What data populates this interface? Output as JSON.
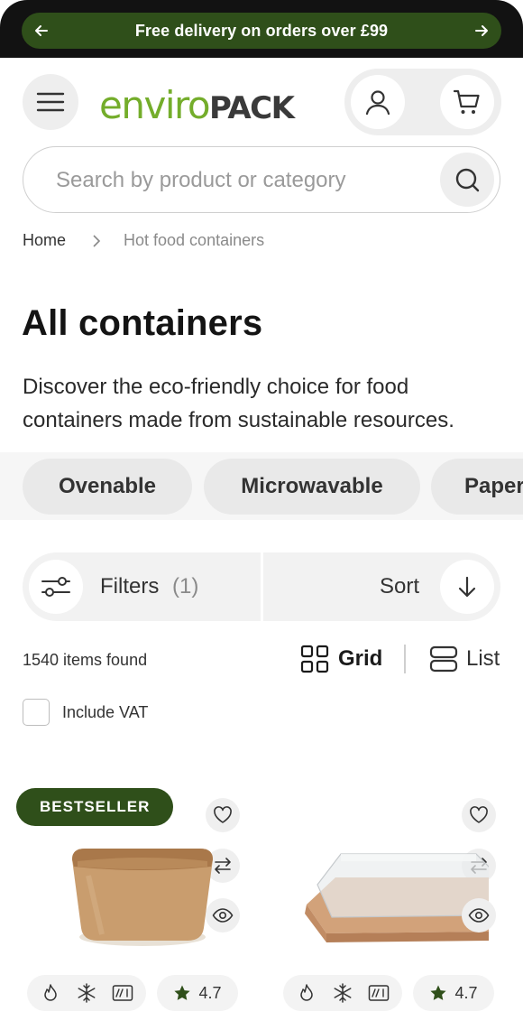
{
  "promo": {
    "text": "Free delivery on orders over £99"
  },
  "header": {
    "logo": {
      "part1": "enviro",
      "part2": "PACK"
    },
    "colors": {
      "brand_green": "#74ad2b",
      "dark_green": "#2f4f1a"
    }
  },
  "search": {
    "placeholder": "Search by product or category"
  },
  "breadcrumb": {
    "home": "Home",
    "current": "Hot food containers"
  },
  "page": {
    "title": "All containers",
    "description": "Discover the eco-friendly choice for food containers made from sustainable resources."
  },
  "chips": [
    "Ovenable",
    "Microwavable",
    "Paper"
  ],
  "filters": {
    "label": "Filters",
    "count": "(1)"
  },
  "sort": {
    "label": "Sort"
  },
  "results": {
    "count_text": "1540 items found"
  },
  "view": {
    "grid_label": "Grid",
    "list_label": "List",
    "selected": "Grid"
  },
  "vat": {
    "label": "Include VAT",
    "checked": false
  },
  "products": [
    {
      "badge": "BESTSELLER",
      "rating": "4.7",
      "features": [
        "flame-icon",
        "snowflake-icon",
        "microwave-icon"
      ]
    },
    {
      "badge": "",
      "rating": "4.7",
      "features": [
        "flame-icon",
        "snowflake-icon",
        "microwave-icon"
      ]
    }
  ]
}
